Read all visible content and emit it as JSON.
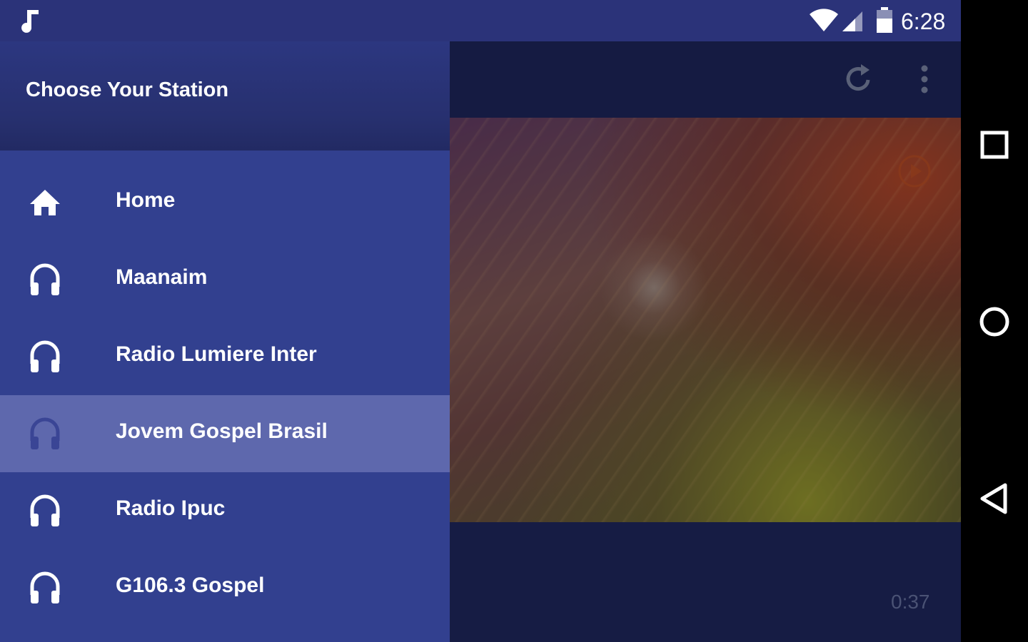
{
  "status_bar": {
    "time": "6:28"
  },
  "drawer": {
    "title": "Choose Your Station",
    "items": [
      {
        "label": "Home",
        "icon": "home-icon",
        "selected": false
      },
      {
        "label": "Maanaim",
        "icon": "headphones-icon",
        "selected": false
      },
      {
        "label": "Radio Lumiere Inter",
        "icon": "headphones-icon",
        "selected": false
      },
      {
        "label": "Jovem Gospel Brasil",
        "icon": "headphones-icon",
        "selected": true
      },
      {
        "label": "Radio Ipuc",
        "icon": "headphones-icon",
        "selected": false
      },
      {
        "label": "G106.3 Gospel",
        "icon": "headphones-icon",
        "selected": false
      }
    ]
  },
  "player": {
    "elapsed": "0:37"
  },
  "colors": {
    "drawer_bg": "#32408f",
    "selected_bg": "#5e68ad",
    "status_bar_bg": "#2b3379"
  }
}
